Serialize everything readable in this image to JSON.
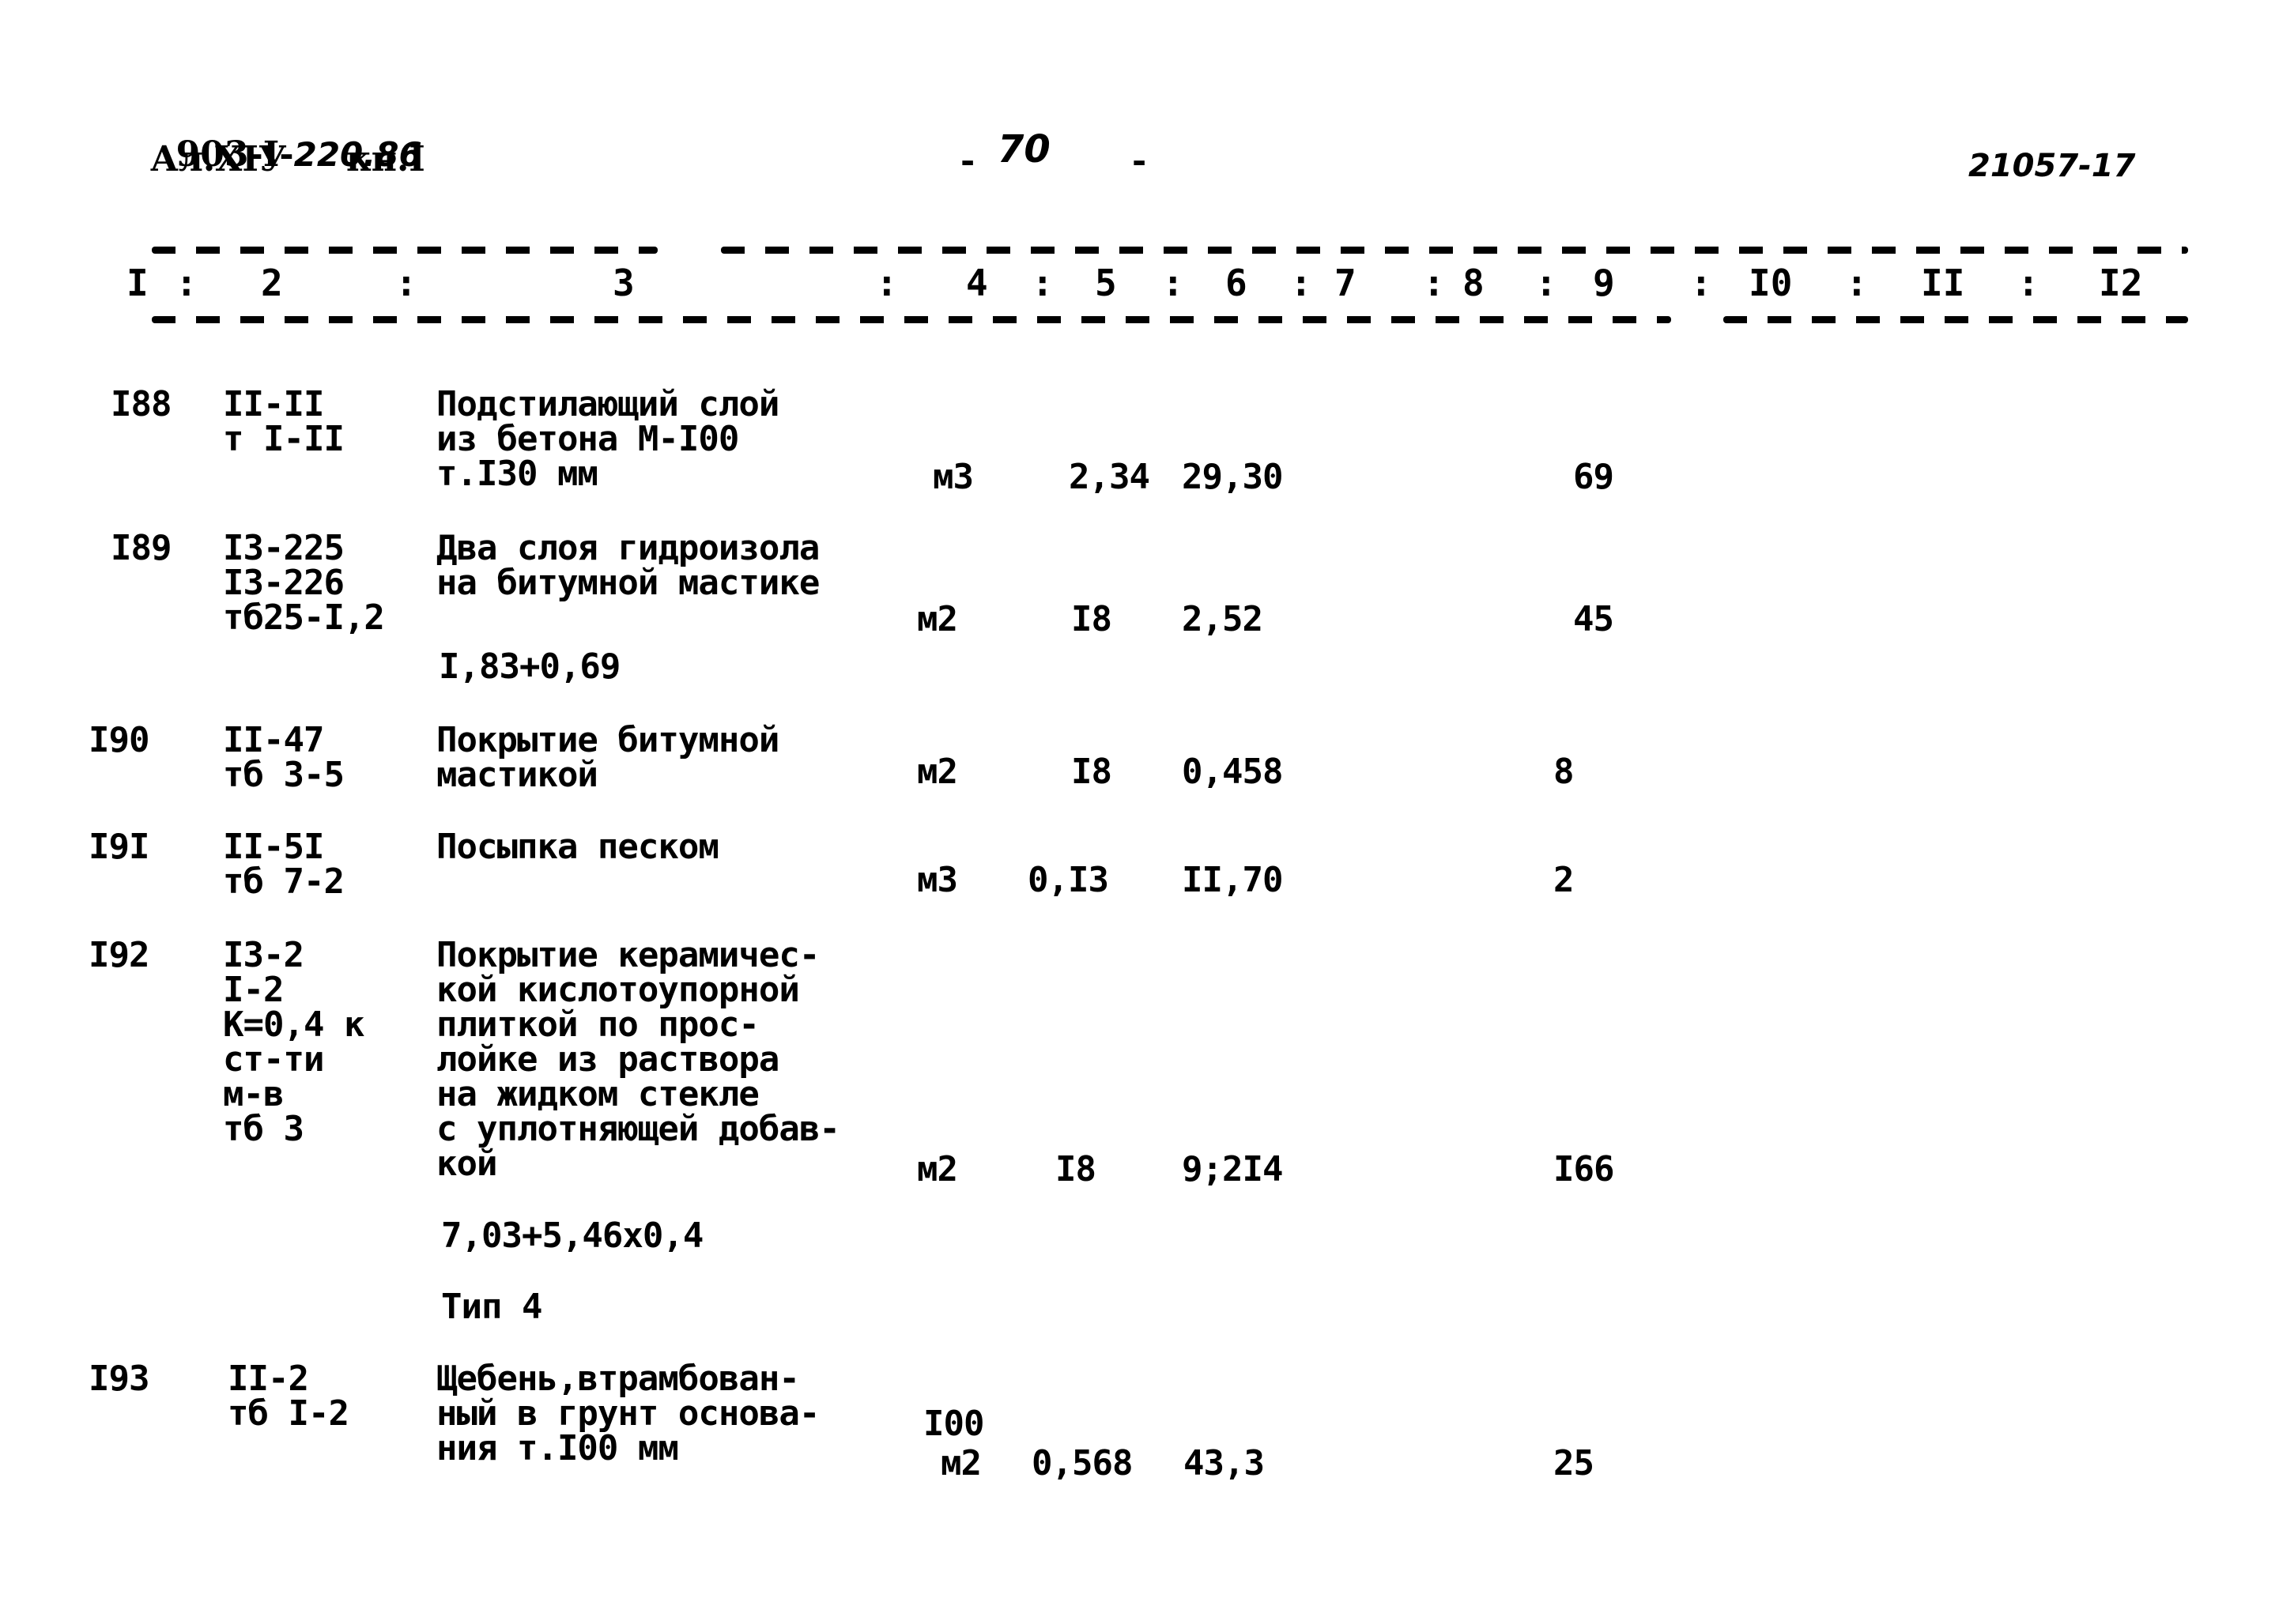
{
  "header": {
    "doc_code_prefix": "903-I-",
    "doc_code_handwritten": "220.86",
    "album": "Ал.XIУ",
    "book": "кн.I",
    "page_number_dash_left": "-",
    "page_number": "70",
    "page_number_dash_right": "-",
    "archive_number": "21057-17"
  },
  "column_headers": [
    "I",
    "2",
    "3",
    "4",
    "5",
    "6",
    "7",
    "8",
    "9",
    "I0",
    "II",
    "I2"
  ],
  "column_separators": [
    ":",
    ":",
    ":",
    ":",
    ":",
    ":",
    ":",
    ":",
    ":",
    ":",
    ":"
  ],
  "rows": [
    {
      "num": "I88",
      "code": [
        "II-II",
        "т I-II"
      ],
      "description": [
        "Подстилающий слой",
        "из бетона М-I00",
        "т.I30 мм"
      ],
      "note": "",
      "unit": "м3",
      "unit_prefix": "",
      "qty": "2,34",
      "price": "29,30",
      "total": "69"
    },
    {
      "num": "I89",
      "code": [
        "I3-225",
        "I3-226",
        "тб25-I,2"
      ],
      "description": [
        "Два слоя гидроизола",
        "на битумной мастике"
      ],
      "note": "I,83+0,69",
      "unit": "м2",
      "unit_prefix": "",
      "qty": "I8",
      "price": "2,52",
      "total": "45"
    },
    {
      "num": "I90",
      "code": [
        "II-47",
        "тб 3-5"
      ],
      "description": [
        "Покрытие битумной",
        "мастикой"
      ],
      "note": "",
      "unit": "м2",
      "unit_prefix": "",
      "qty": "I8",
      "price": "0,458",
      "total": "8"
    },
    {
      "num": "I9I",
      "code": [
        "II-5I",
        "тб 7-2"
      ],
      "description": [
        "Посыпка песком"
      ],
      "note": "",
      "unit": "м3",
      "unit_prefix": "",
      "qty": "0,I3",
      "price": "II,70",
      "total": "2"
    },
    {
      "num": "I92",
      "code": [
        "I3-2",
        "I-2",
        "К=0,4 к",
        "ст-ти",
        "м-в",
        "тб 3"
      ],
      "description": [
        "Покрытие керамичес-",
        "кой кислотоупорной",
        "плиткой по прос-",
        "лойке из раствора",
        "на жидком стекле",
        "с уплотняющей добав-",
        "кой"
      ],
      "note": "7,03+5,46x0,4",
      "note2": "Тип 4",
      "unit": "м2",
      "unit_prefix": "",
      "qty": "I8",
      "price": "9;2I4",
      "total": "I66"
    },
    {
      "num": "I93",
      "code": [
        "II-2",
        "тб I-2"
      ],
      "description": [
        "Щебень,втрамбован-",
        "ный в грунт основа-",
        "ния т.I00 мм"
      ],
      "note": "",
      "unit": "м2",
      "unit_prefix": "I00",
      "qty": "0,568",
      "price": "43,3",
      "total": "25"
    }
  ]
}
